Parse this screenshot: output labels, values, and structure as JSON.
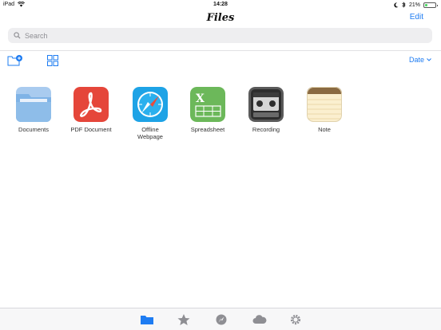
{
  "status_bar": {
    "device": "iPad",
    "time": "14:28",
    "battery_percent": "21%",
    "battery_level": 0.21
  },
  "header": {
    "title": "Files",
    "edit_label": "Edit"
  },
  "search": {
    "placeholder": "Search"
  },
  "toolbar": {
    "sort_label": "Date"
  },
  "items": [
    {
      "label": "Documents",
      "icon": "folder-icon"
    },
    {
      "label": "PDF Document",
      "icon": "pdf-icon"
    },
    {
      "label": "Offline Webpage",
      "icon": "compass-icon"
    },
    {
      "label": "Spreadsheet",
      "icon": "spreadsheet-icon"
    },
    {
      "label": "Recording",
      "icon": "recorder-icon"
    },
    {
      "label": "Note",
      "icon": "notepad-icon"
    }
  ],
  "tabbar": {
    "tabs": [
      "folder-icon",
      "star-icon",
      "compass-icon",
      "cloud-icon",
      "gear-icon"
    ],
    "active_tab": "folder-icon"
  },
  "colors": {
    "accent": "#1e7cf2",
    "pdf_red": "#e5463a",
    "browser_blue": "#1ea3e6",
    "sheet_green": "#6cb85a",
    "recorder_gray": "#5a5a5a",
    "note_yellow": "#fbefcf"
  }
}
